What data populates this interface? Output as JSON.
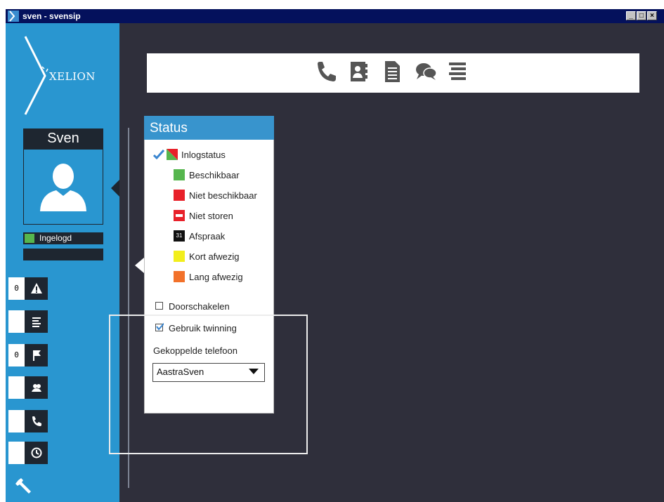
{
  "window": {
    "title": "sven - svensip",
    "controls": [
      "_",
      "□",
      "×"
    ]
  },
  "brand": {
    "logo_text": "XELION"
  },
  "user": {
    "name": "Sven",
    "status_label": "Ingelogd",
    "status_color": "#56b64e"
  },
  "sidebar_nav": [
    {
      "count": "0",
      "icon": "warning-icon"
    },
    {
      "count": "",
      "icon": "list-icon"
    },
    {
      "count": "0",
      "icon": "flag-icon"
    },
    {
      "count": "",
      "icon": "contacts-icon"
    },
    {
      "count": "",
      "icon": "phone-icon"
    },
    {
      "count": "",
      "icon": "history-icon"
    }
  ],
  "settings_icon": "wrench-icon",
  "toolbar": {
    "icons": [
      "phone-icon",
      "addressbook-icon",
      "document-icon",
      "chat-icon",
      "menu-icon"
    ]
  },
  "status_popup": {
    "title": "Status",
    "items": [
      {
        "label": "Inlogstatus",
        "color": "split-green-red",
        "checked": true
      },
      {
        "label": "Beschikbaar",
        "color": "#56b64e"
      },
      {
        "label": "Niet beschikbaar",
        "color": "#e8212a"
      },
      {
        "label": "Niet storen",
        "color": "#e8212a",
        "icon": "do-not-disturb-icon"
      },
      {
        "label": "Afspraak",
        "color": "#111111",
        "badge": "31"
      },
      {
        "label": "Kort afwezig",
        "color": "#f2ee1c"
      },
      {
        "label": "Lang afwezig",
        "color": "#f2712a"
      }
    ],
    "forward": {
      "label": "Doorschakelen",
      "checked": false
    },
    "twinning": {
      "label": "Gebruik twinning",
      "checked": true
    },
    "linked_phone": {
      "label": "Gekoppelde telefoon",
      "value": "AastraSven"
    }
  },
  "colors": {
    "sidebar": "#2996d0",
    "background": "#2f2f3b",
    "titlebar": "#04115c",
    "popup_header": "#3894cd"
  }
}
